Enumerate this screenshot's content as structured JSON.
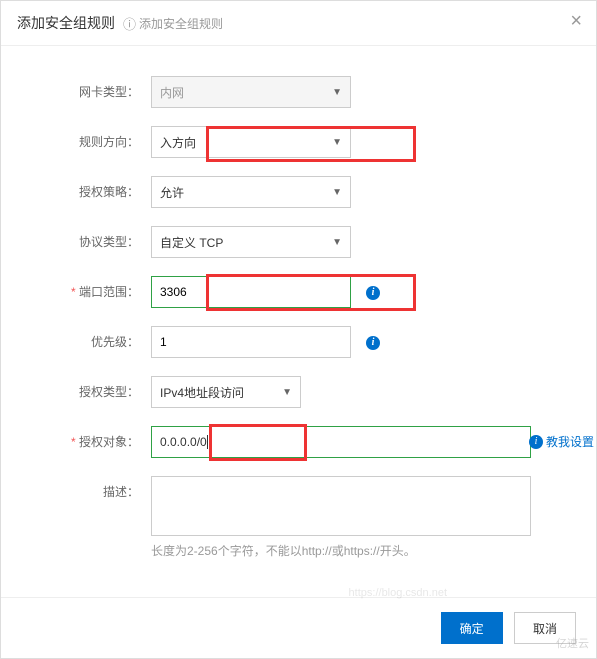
{
  "header": {
    "title": "添加安全组规则",
    "help_link": "添加安全组规则"
  },
  "form": {
    "nic_type": {
      "label": "网卡类型：",
      "value": "内网"
    },
    "direction": {
      "label": "规则方向：",
      "value": "入方向"
    },
    "policy": {
      "label": "授权策略：",
      "value": "允许"
    },
    "protocol": {
      "label": "协议类型：",
      "value": "自定义 TCP"
    },
    "port_range": {
      "label": "端口范围：",
      "value": "3306"
    },
    "priority": {
      "label": "优先级：",
      "value": "1"
    },
    "auth_type": {
      "label": "授权类型：",
      "value": "IPv4地址段访问"
    },
    "auth_object": {
      "label": "授权对象：",
      "value": "0.0.0.0/0",
      "teach": "教我设置"
    },
    "description": {
      "label": "描述：",
      "value": "",
      "hint": "长度为2-256个字符，不能以http://或https://开头。"
    }
  },
  "footer": {
    "ok": "确定",
    "cancel": "取消"
  },
  "watermark": "亿速云",
  "watermark2": "https://blog.csdn.net"
}
